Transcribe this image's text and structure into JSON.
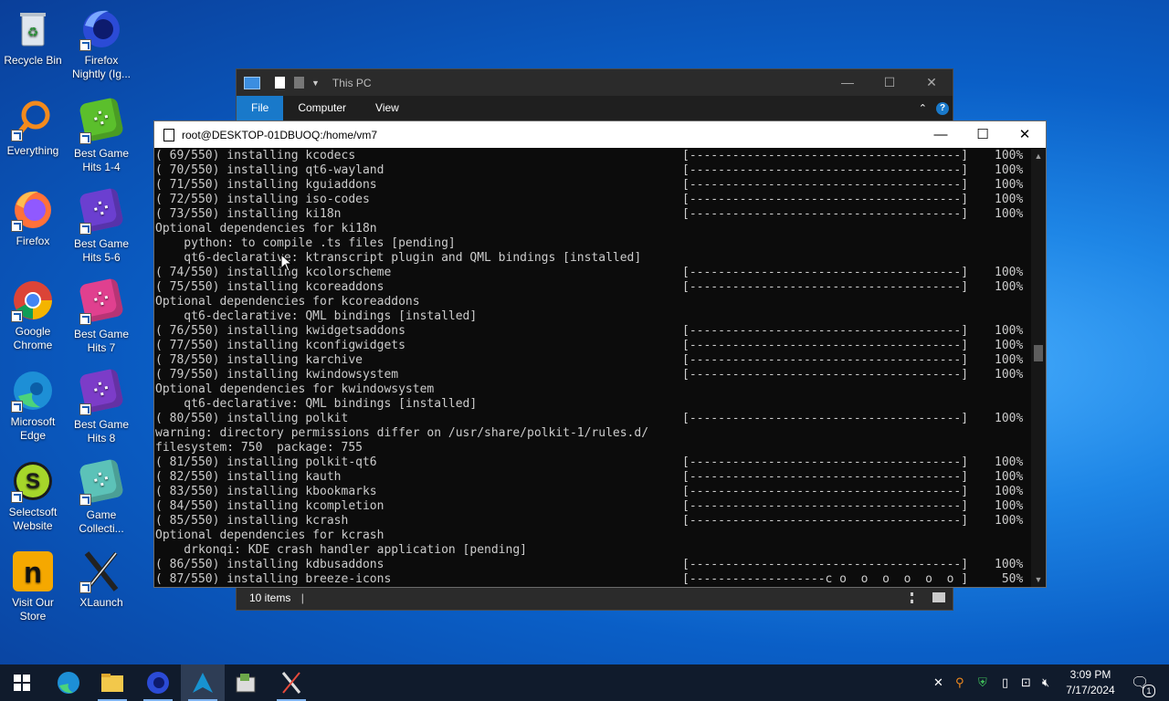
{
  "desktop": {
    "icons_col1": [
      {
        "label": "Recycle Bin",
        "icon": "recycle-bin-icon"
      },
      {
        "label": "Everything",
        "icon": "everything-search-icon"
      },
      {
        "label": "Firefox",
        "icon": "firefox-icon"
      },
      {
        "label": "Google Chrome",
        "icon": "chrome-icon"
      },
      {
        "label": "Microsoft Edge",
        "icon": "edge-icon"
      },
      {
        "label": "Selectsoft Website",
        "icon": "selectsoft-icon"
      },
      {
        "label": "Visit Our Store",
        "icon": "store-icon"
      }
    ],
    "icons_col2": [
      {
        "label": "Firefox Nightly (Ig...",
        "icon": "firefox-nightly-icon"
      },
      {
        "label": "Best Game Hits 1-4",
        "icon": "dice-green-icon"
      },
      {
        "label": "Best Game Hits 5-6",
        "icon": "dice-purple-icon"
      },
      {
        "label": "Best Game Hits 7",
        "icon": "dice-pink-icon"
      },
      {
        "label": "Best Game Hits 8",
        "icon": "dice-purple-icon"
      },
      {
        "label": "Game Collecti...",
        "icon": "dice-teal-icon"
      },
      {
        "label": "XLaunch",
        "icon": "xlaunch-icon"
      }
    ]
  },
  "explorer": {
    "title": "This PC",
    "tabs": [
      "File",
      "Computer",
      "View"
    ],
    "status": "10 items",
    "colors": {
      "active_tab": "#1979ca"
    }
  },
  "terminal": {
    "title": "root@DESKTOP-01DBUOQ:/home/vm7",
    "lines": [
      {
        "text": "( 69/550) installing kcodecs",
        "bar": "[--------------------------------------]",
        "pct": "100%"
      },
      {
        "text": "( 70/550) installing qt6-wayland",
        "bar": "[--------------------------------------]",
        "pct": "100%"
      },
      {
        "text": "( 71/550) installing kguiaddons",
        "bar": "[--------------------------------------]",
        "pct": "100%"
      },
      {
        "text": "( 72/550) installing iso-codes",
        "bar": "[--------------------------------------]",
        "pct": "100%"
      },
      {
        "text": "( 73/550) installing ki18n",
        "bar": "[--------------------------------------]",
        "pct": "100%"
      },
      {
        "text": "Optional dependencies for ki18n",
        "bar": "",
        "pct": ""
      },
      {
        "text": "    python: to compile .ts files [pending]",
        "bar": "",
        "pct": ""
      },
      {
        "text": "    qt6-declarative: ktranscript plugin and QML bindings [installed]",
        "bar": "",
        "pct": ""
      },
      {
        "text": "( 74/550) installing kcolorscheme",
        "bar": "[--------------------------------------]",
        "pct": "100%"
      },
      {
        "text": "( 75/550) installing kcoreaddons",
        "bar": "[--------------------------------------]",
        "pct": "100%"
      },
      {
        "text": "Optional dependencies for kcoreaddons",
        "bar": "",
        "pct": ""
      },
      {
        "text": "    qt6-declarative: QML bindings [installed]",
        "bar": "",
        "pct": ""
      },
      {
        "text": "( 76/550) installing kwidgetsaddons",
        "bar": "[--------------------------------------]",
        "pct": "100%"
      },
      {
        "text": "( 77/550) installing kconfigwidgets",
        "bar": "[--------------------------------------]",
        "pct": "100%"
      },
      {
        "text": "( 78/550) installing karchive",
        "bar": "[--------------------------------------]",
        "pct": "100%"
      },
      {
        "text": "( 79/550) installing kwindowsystem",
        "bar": "[--------------------------------------]",
        "pct": "100%"
      },
      {
        "text": "Optional dependencies for kwindowsystem",
        "bar": "",
        "pct": ""
      },
      {
        "text": "    qt6-declarative: QML bindings [installed]",
        "bar": "",
        "pct": ""
      },
      {
        "text": "( 80/550) installing polkit",
        "bar": "[--------------------------------------]",
        "pct": "100%"
      },
      {
        "text": "warning: directory permissions differ on /usr/share/polkit-1/rules.d/",
        "bar": "",
        "pct": ""
      },
      {
        "text": "filesystem: 750  package: 755",
        "bar": "",
        "pct": ""
      },
      {
        "text": "( 81/550) installing polkit-qt6",
        "bar": "[--------------------------------------]",
        "pct": "100%"
      },
      {
        "text": "( 82/550) installing kauth",
        "bar": "[--------------------------------------]",
        "pct": "100%"
      },
      {
        "text": "( 83/550) installing kbookmarks",
        "bar": "[--------------------------------------]",
        "pct": "100%"
      },
      {
        "text": "( 84/550) installing kcompletion",
        "bar": "[--------------------------------------]",
        "pct": "100%"
      },
      {
        "text": "( 85/550) installing kcrash",
        "bar": "[--------------------------------------]",
        "pct": "100%"
      },
      {
        "text": "Optional dependencies for kcrash",
        "bar": "",
        "pct": ""
      },
      {
        "text": "    drkonqi: KDE crash handler application [pending]",
        "bar": "",
        "pct": ""
      },
      {
        "text": "( 86/550) installing kdbusaddons",
        "bar": "[--------------------------------------]",
        "pct": "100%"
      },
      {
        "text": "( 87/550) installing breeze-icons",
        "bar": "[-------------------c o  o  o  o  o  o ]",
        "pct": " 50%"
      }
    ]
  },
  "taskbar": {
    "apps": [
      {
        "name": "start-button",
        "icon": "windows-logo-icon"
      },
      {
        "name": "taskbar-edge",
        "icon": "edge-icon"
      },
      {
        "name": "taskbar-file-explorer",
        "icon": "folder-icon"
      },
      {
        "name": "taskbar-firefox-nightly",
        "icon": "firefox-nightly-icon"
      },
      {
        "name": "taskbar-arch-terminal",
        "icon": "arch-linux-icon"
      },
      {
        "name": "taskbar-app",
        "icon": "installer-icon"
      },
      {
        "name": "taskbar-xlaunch",
        "icon": "xlaunch-icon"
      }
    ],
    "clock": {
      "time": "3:09 PM",
      "date": "7/17/2024"
    },
    "notification_count": "1"
  }
}
